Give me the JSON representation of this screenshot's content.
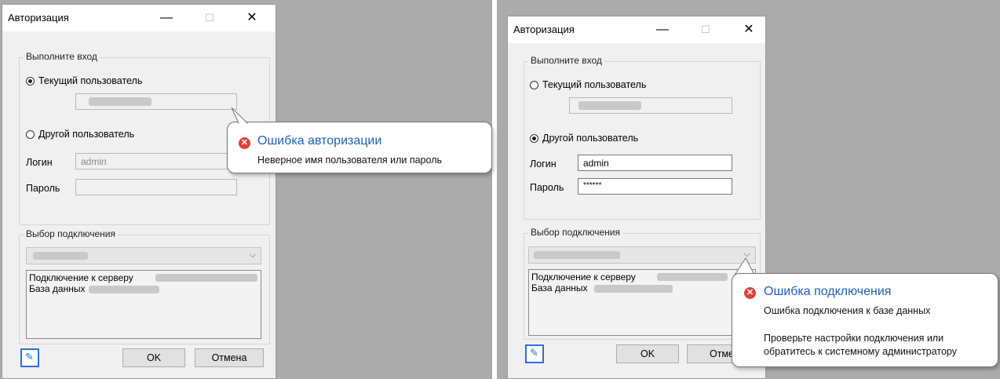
{
  "left": {
    "window_title": "Авторизация",
    "minimize": "—",
    "maximize": "☐",
    "close": "✕",
    "group_login": "Выполните вход",
    "radio_current": "Текущий пользователь",
    "radio_other": "Другой пользователь",
    "current_selected": true,
    "login_label": "Логин",
    "login_value": "admin",
    "password_label": "Пароль",
    "password_value": "",
    "group_connection": "Выбор подключения",
    "info_line1": "Подключение к серверу",
    "info_line2": "База данных",
    "ok": "OK",
    "cancel": "Отмена",
    "error_title": "Ошибка авторизации",
    "error_message": "Неверное имя пользователя или пароль"
  },
  "right": {
    "window_title": "Авторизация",
    "minimize": "—",
    "maximize": "☐",
    "close": "✕",
    "group_login": "Выполните вход",
    "radio_current": "Текущий пользователь",
    "radio_other": "Другой пользователь",
    "current_selected": false,
    "login_label": "Логин",
    "login_value": "admin",
    "password_label": "Пароль",
    "password_value": "******",
    "group_connection": "Выбор подключения",
    "info_line1": "Подключение к серверу",
    "info_line2": "База данных",
    "ok": "OK",
    "cancel": "Отме",
    "error_title": "Ошибка подключения",
    "error_message1": "Ошибка подключения к базе данных",
    "error_message2": "Проверьте настройки подключения или обратитесь к системному администратору"
  }
}
